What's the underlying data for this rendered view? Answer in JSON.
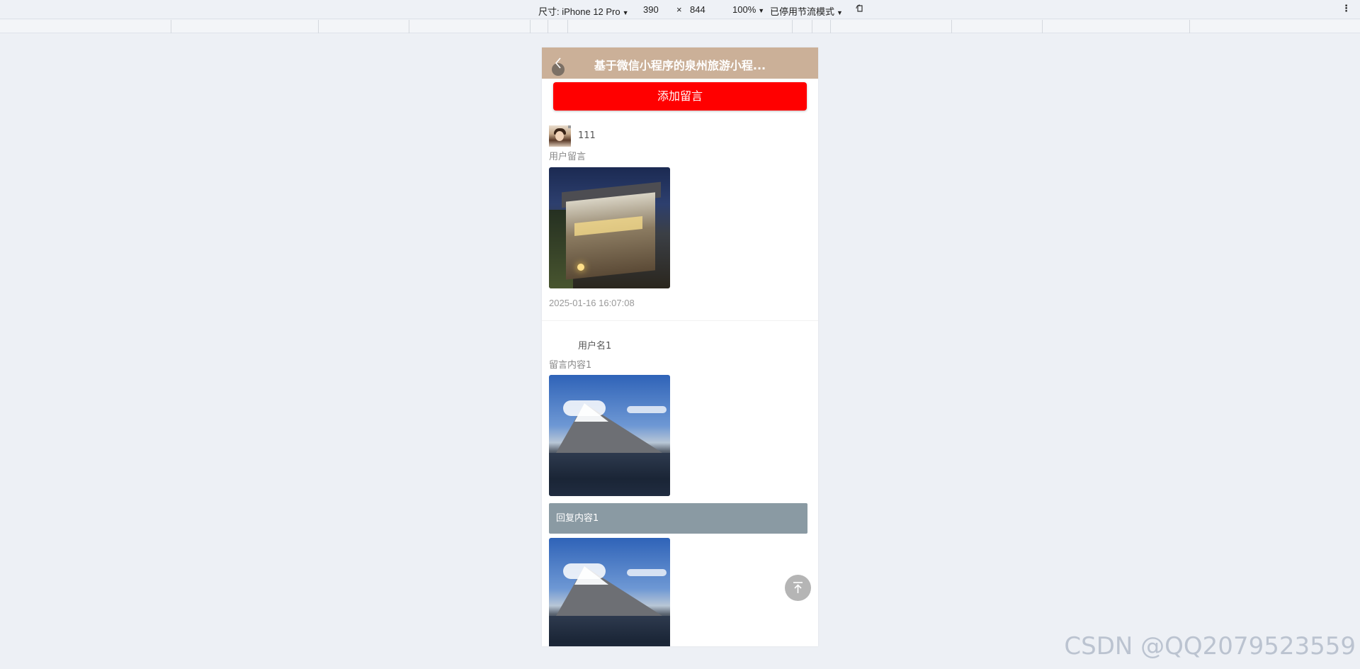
{
  "devtools": {
    "device_label": "尺寸: iPhone 12 Pro",
    "width": "390",
    "times": "×",
    "height": "844",
    "zoom": "100%",
    "throttle": "已停用节流模式",
    "rotate_icon": "rotate-icon",
    "more_icon": "more-icon"
  },
  "app": {
    "nav_title": "基于微信小程序的泉州旅游小程...",
    "back_icon": "chevron-left-icon",
    "add_button": "添加留言",
    "messages": [
      {
        "username": "111",
        "content": "用户留言",
        "image": "house-photo",
        "time": "2025-01-16 16:07:08"
      },
      {
        "username": "用户名1",
        "content": "留言内容1",
        "image": "mountain-photo",
        "reply": "回复内容1",
        "reply_image": "mountain-photo"
      }
    ],
    "back_to_top_icon": "arrow-up-to-top-icon"
  },
  "watermark": "CSDN @QQ2079523559",
  "colors": {
    "navbar": "#cbb098",
    "add_button": "#ff0000",
    "reply_bg": "#8a9aa3",
    "page_bg": "#edf0f5"
  }
}
